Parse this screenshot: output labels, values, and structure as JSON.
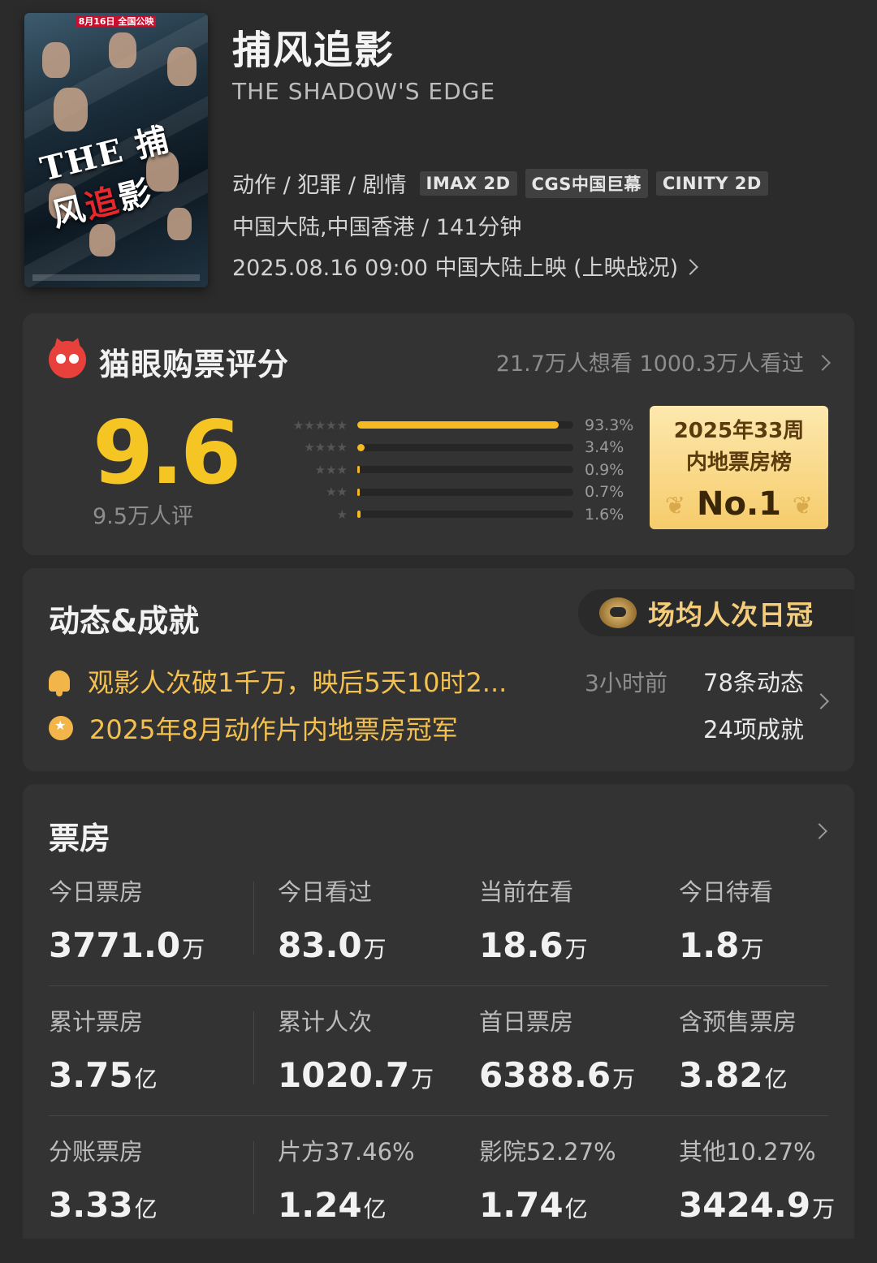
{
  "movie": {
    "title_cn": "捕风追影",
    "title_en": "THE SHADOW'S EDGE",
    "genres": "动作 / 犯罪 / 剧情",
    "tags": [
      "IMAX 2D",
      "CGS中国巨幕",
      "CINITY 2D"
    ],
    "region_duration": "中国大陆,中国香港 / 141分钟",
    "release": "2025.08.16 09:00 中国大陆上映 (上映战况)",
    "poster": {
      "top_caption": "8月16日 全国公映",
      "title_text_a": "THE 捕风",
      "title_text_b": "追",
      "title_text_c": "影"
    }
  },
  "rating": {
    "title": "猫眼购票评分",
    "stats": "21.7万人想看 1000.3万人看过",
    "score": "9.6",
    "count": "9.5万人评",
    "distribution": [
      {
        "stars": "★★★★★",
        "pct_value": 93.3,
        "label": "93.3%"
      },
      {
        "stars": "★★★★",
        "pct_value": 3.4,
        "label": "3.4%"
      },
      {
        "stars": "★★★",
        "pct_value": 0.9,
        "label": "0.9%"
      },
      {
        "stars": "★★",
        "pct_value": 0.7,
        "label": "0.7%"
      },
      {
        "stars": "★",
        "pct_value": 1.6,
        "label": "1.6%"
      }
    ],
    "rank": {
      "line1": "2025年33周",
      "line2": "内地票房榜",
      "line3": "No.1"
    }
  },
  "dynamics": {
    "title": "动态&成就",
    "badge": "场均人次日冠",
    "news": "观影人次破1千万，映后5天10时2...",
    "time": "3小时前",
    "achievement": "2025年8月动作片内地票房冠军",
    "count_news": "78条动态",
    "count_achievements": "24项成就"
  },
  "box_office": {
    "title": "票房",
    "rows": [
      [
        {
          "label": "今日票房",
          "value": "3771.0",
          "unit": "万"
        },
        {
          "label": "今日看过",
          "value": "83.0",
          "unit": "万"
        },
        {
          "label": "当前在看",
          "value": "18.6",
          "unit": "万"
        },
        {
          "label": "今日待看",
          "value": "1.8",
          "unit": "万"
        }
      ],
      [
        {
          "label": "累计票房",
          "value": "3.75",
          "unit": "亿"
        },
        {
          "label": "累计人次",
          "value": "1020.7",
          "unit": "万"
        },
        {
          "label": "首日票房",
          "value": "6388.6",
          "unit": "万"
        },
        {
          "label": "含预售票房",
          "value": "3.82",
          "unit": "亿"
        }
      ],
      [
        {
          "label": "分账票房",
          "value": "3.33",
          "unit": "亿"
        },
        {
          "label": "片方37.46%",
          "value": "1.24",
          "unit": "亿"
        },
        {
          "label": "影院52.27%",
          "value": "1.74",
          "unit": "亿"
        },
        {
          "label": "其他10.27%",
          "value": "3424.9",
          "unit": "万"
        }
      ]
    ]
  }
}
